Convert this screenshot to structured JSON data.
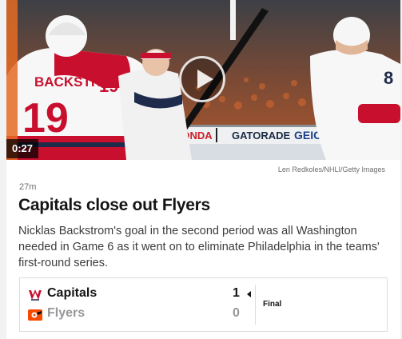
{
  "video": {
    "duration": "0:27",
    "credit": "Len Redkoles/NHLI/Getty Images",
    "board_ads": [
      "HONDA",
      "GATORADE",
      "GEICO"
    ],
    "jersey_names": [
      "BACKSTROM"
    ],
    "jersey_numbers": [
      "19",
      "19",
      "8"
    ]
  },
  "article": {
    "timestamp": "27m",
    "headline": "Capitals close out Flyers",
    "summary": "Nicklas Backstrom's goal in the second period was all Washington needed in Game 6 as it went on to eliminate Philadelphia in the teams' first-round series."
  },
  "scoreboard": {
    "status": "Final",
    "teams": [
      {
        "name": "Capitals",
        "score": "1",
        "logo": "capitals-logo",
        "color": "#c8102e",
        "winner": true
      },
      {
        "name": "Flyers",
        "score": "0",
        "logo": "flyers-logo",
        "color": "#f74902",
        "winner": false
      }
    ]
  },
  "colors": {
    "accent_red": "#c8102e",
    "text_primary": "#141414",
    "text_muted": "#96979a"
  }
}
